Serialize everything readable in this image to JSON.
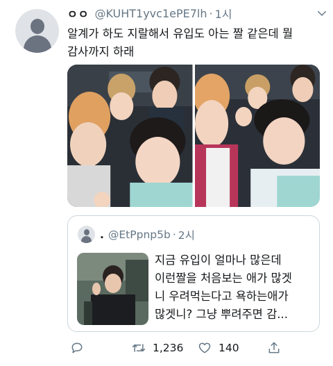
{
  "tweet": {
    "display_name": "ㅇㅇ",
    "handle": "@KUHT1yvc1ePE7lh",
    "separator": "·",
    "time": "1시",
    "text_lines": [
      "알계가 하도 지랄해서 유입도 아는 짤 같은데 뭘",
      "감사까지 하래"
    ],
    "media_count": 2
  },
  "quoted_tweet": {
    "display_name": ".",
    "handle": "@EtPpnp5b",
    "separator": "·",
    "time": "2시",
    "text_lines": [
      "지금 유입이 얼마나 많은데",
      "이런짤을 처음보는 애가 많겟",
      "니 우려먹는다고 욕하는애가",
      "많겟니? 그냥 뿌려주면 감..."
    ]
  },
  "actions": {
    "reply_icon": "reply-icon",
    "retweet_icon": "retweet-icon",
    "retweet_count": "1,236",
    "like_icon": "heart-icon",
    "like_count": "140",
    "share_icon": "share-icon"
  },
  "colors": {
    "text_primary": "#14171a",
    "text_secondary": "#657786",
    "border": "#ccd6dd",
    "icon": "#657786"
  }
}
